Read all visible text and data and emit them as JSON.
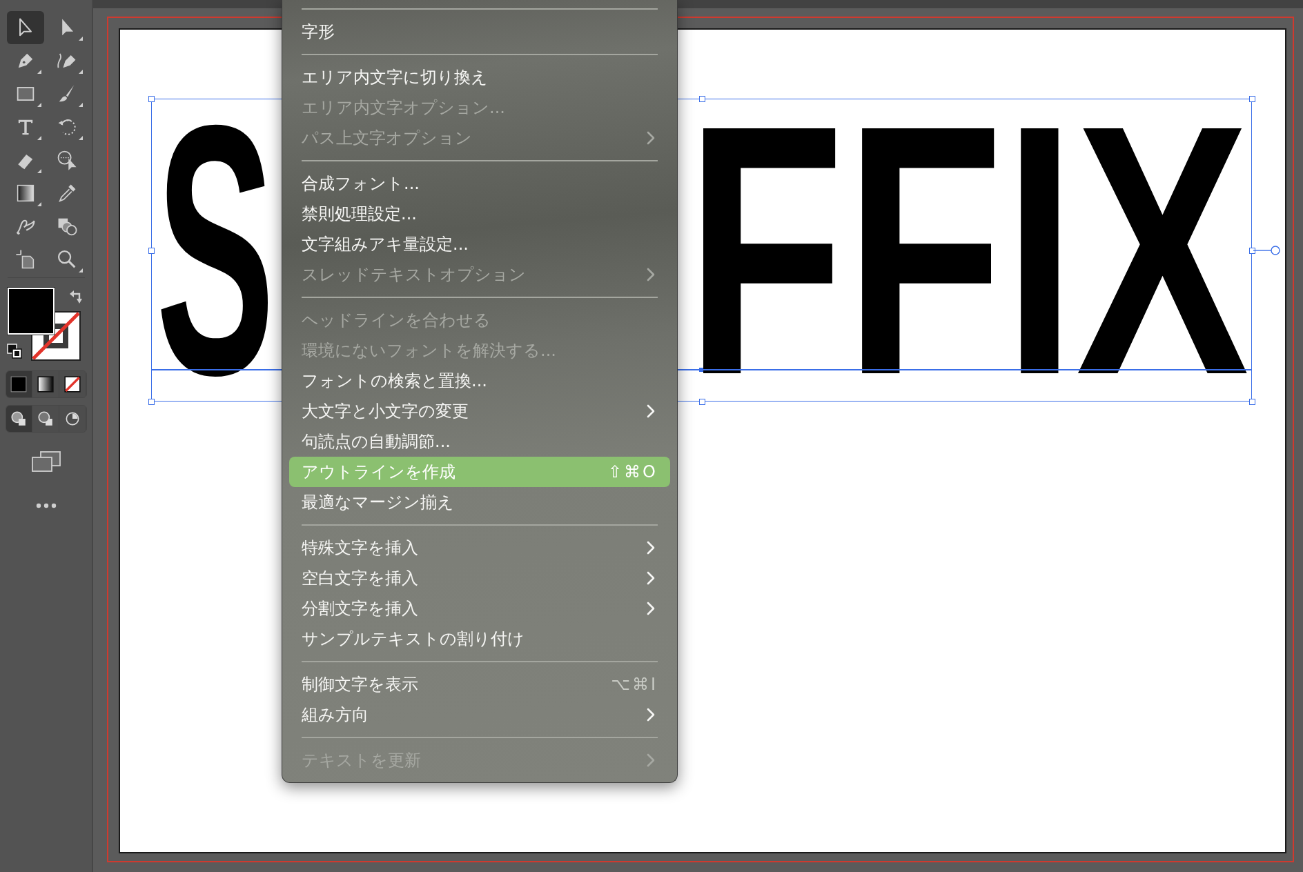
{
  "tools": [
    {
      "kind": "selection",
      "selected": true,
      "flyout": false
    },
    {
      "kind": "direct-selection",
      "selected": false,
      "flyout": true
    },
    {
      "kind": "pen",
      "selected": false,
      "flyout": true
    },
    {
      "kind": "curvature",
      "selected": false,
      "flyout": true
    },
    {
      "kind": "rectangle",
      "selected": false,
      "flyout": true
    },
    {
      "kind": "paintbrush",
      "selected": false,
      "flyout": true
    },
    {
      "kind": "type",
      "selected": false,
      "flyout": true
    },
    {
      "kind": "rotate",
      "selected": false,
      "flyout": true
    },
    {
      "kind": "eraser",
      "selected": false,
      "flyout": true
    },
    {
      "kind": "shape-builder",
      "selected": false,
      "flyout": false
    },
    {
      "kind": "gradient",
      "selected": false,
      "flyout": true
    },
    {
      "kind": "eyedropper",
      "selected": false,
      "flyout": false
    },
    {
      "kind": "puppet-warp",
      "selected": false,
      "flyout": false
    },
    {
      "kind": "shapes",
      "selected": false,
      "flyout": false
    },
    {
      "kind": "artboard",
      "selected": false,
      "flyout": false
    },
    {
      "kind": "zoom",
      "selected": false,
      "flyout": true
    }
  ],
  "color_modes": [
    {
      "kind": "color",
      "selected": true
    },
    {
      "kind": "gradient",
      "selected": false
    },
    {
      "kind": "none",
      "selected": false
    }
  ],
  "draw_modes": [
    {
      "kind": "normal",
      "selected": true
    },
    {
      "kind": "behind",
      "selected": false
    },
    {
      "kind": "inside",
      "selected": false
    }
  ],
  "artwork_text": [
    {
      "text": "S"
    },
    {
      "text": "FFIX"
    }
  ],
  "menu": {
    "items": [
      {
        "kind": "separator"
      },
      {
        "kind": "item",
        "label": "字形",
        "disabled": false,
        "selected": false,
        "submenu": false
      },
      {
        "kind": "separator"
      },
      {
        "kind": "item",
        "label": "エリア内文字に切り換え",
        "disabled": false,
        "selected": false,
        "submenu": false
      },
      {
        "kind": "item",
        "label": "エリア内文字オプション...",
        "disabled": true,
        "selected": false,
        "submenu": false
      },
      {
        "kind": "item",
        "label": "パス上文字オプション",
        "disabled": true,
        "selected": false,
        "submenu": true
      },
      {
        "kind": "separator"
      },
      {
        "kind": "item",
        "label": "合成フォント...",
        "disabled": false,
        "selected": false,
        "submenu": false
      },
      {
        "kind": "item",
        "label": "禁則処理設定...",
        "disabled": false,
        "selected": false,
        "submenu": false
      },
      {
        "kind": "item",
        "label": "文字組みアキ量設定...",
        "disabled": false,
        "selected": false,
        "submenu": false
      },
      {
        "kind": "item",
        "label": "スレッドテキストオプション",
        "disabled": true,
        "selected": false,
        "submenu": true
      },
      {
        "kind": "separator"
      },
      {
        "kind": "item",
        "label": "ヘッドラインを合わせる",
        "disabled": true,
        "selected": false,
        "submenu": false
      },
      {
        "kind": "item",
        "label": "環境にないフォントを解決する...",
        "disabled": true,
        "selected": false,
        "submenu": false
      },
      {
        "kind": "item",
        "label": "フォントの検索と置換...",
        "disabled": false,
        "selected": false,
        "submenu": false
      },
      {
        "kind": "item",
        "label": "大文字と小文字の変更",
        "disabled": false,
        "selected": false,
        "submenu": true
      },
      {
        "kind": "item",
        "label": "句読点の自動調節...",
        "disabled": false,
        "selected": false,
        "submenu": false
      },
      {
        "kind": "item",
        "label": "アウトラインを作成",
        "disabled": false,
        "selected": true,
        "submenu": false,
        "shortcut": "⇧⌘O"
      },
      {
        "kind": "item",
        "label": "最適なマージン揃え",
        "disabled": false,
        "selected": false,
        "submenu": false
      },
      {
        "kind": "separator"
      },
      {
        "kind": "item",
        "label": "特殊文字を挿入",
        "disabled": false,
        "selected": false,
        "submenu": true
      },
      {
        "kind": "item",
        "label": "空白文字を挿入",
        "disabled": false,
        "selected": false,
        "submenu": true
      },
      {
        "kind": "item",
        "label": "分割文字を挿入",
        "disabled": false,
        "selected": false,
        "submenu": true
      },
      {
        "kind": "item",
        "label": "サンプルテキストの割り付け",
        "disabled": false,
        "selected": false,
        "submenu": false
      },
      {
        "kind": "separator"
      },
      {
        "kind": "item",
        "label": "制御文字を表示",
        "disabled": false,
        "selected": false,
        "submenu": false,
        "shortcut": "⌥⌘I"
      },
      {
        "kind": "item",
        "label": "組み方向",
        "disabled": false,
        "selected": false,
        "submenu": true
      },
      {
        "kind": "separator"
      },
      {
        "kind": "item",
        "label": "テキストを更新",
        "disabled": true,
        "selected": false,
        "submenu": true
      }
    ]
  }
}
